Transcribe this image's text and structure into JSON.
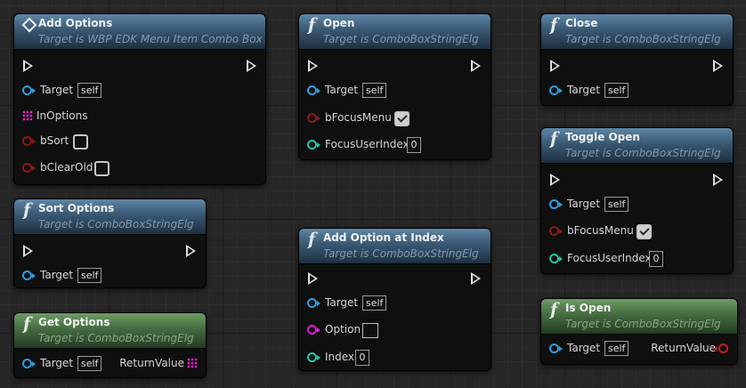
{
  "nodes": {
    "add_options": {
      "title": "Add Options",
      "subtitle": "Target is WBP EDK Menu Item Combo Box",
      "pins": {
        "target": "Target",
        "target_default": "self",
        "in_options": "InOptions",
        "b_sort": "bSort",
        "b_clear_old": "bClearOld"
      },
      "b_sort_checked": false,
      "b_clear_old_checked": false
    },
    "sort_options": {
      "title": "Sort Options",
      "subtitle": "Target is ComboBoxStringElg",
      "pins": {
        "target": "Target",
        "target_default": "self"
      }
    },
    "get_options": {
      "title": "Get Options",
      "subtitle": "Target is ComboBoxStringElg",
      "pins": {
        "target": "Target",
        "target_default": "self",
        "return_value": "ReturnValue"
      }
    },
    "open": {
      "title": "Open",
      "subtitle": "Target is ComboBoxStringElg",
      "pins": {
        "target": "Target",
        "target_default": "self",
        "b_focus_menu": "bFocusMenu",
        "focus_user_index": "FocusUserIndex",
        "focus_user_index_value": "0"
      },
      "b_focus_menu_checked": true
    },
    "add_option_at_index": {
      "title": "Add Option at Index",
      "subtitle": "Target is ComboBoxStringElg",
      "pins": {
        "target": "Target",
        "target_default": "self",
        "option": "Option",
        "index": "Index",
        "index_value": "0"
      }
    },
    "close": {
      "title": "Close",
      "subtitle": "Target is ComboBoxStringElg",
      "pins": {
        "target": "Target",
        "target_default": "self"
      }
    },
    "toggle_open": {
      "title": "Toggle Open",
      "subtitle": "Target is ComboBoxStringElg",
      "pins": {
        "target": "Target",
        "target_default": "self",
        "b_focus_menu": "bFocusMenu",
        "focus_user_index": "FocusUserIndex",
        "focus_user_index_value": "0"
      },
      "b_focus_menu_checked": true
    },
    "is_open": {
      "title": "Is Open",
      "subtitle": "Target is ComboBoxStringElg",
      "pins": {
        "target": "Target",
        "target_default": "self",
        "return_value": "ReturnValue"
      }
    }
  },
  "icons": {
    "function": "f-function-icon",
    "event": "diamond-event-icon",
    "exec": "exec-pin-icon",
    "object": "object-pin-icon",
    "bool": "bool-pin-icon",
    "int": "int-pin-icon",
    "string": "string-pin-icon",
    "array": "array-pin-icon"
  },
  "colors": {
    "impure_header": "#3b5a75",
    "pure_header": "#476e42",
    "object_pin": "#2e9fe0",
    "bool_pin": "#8b1a1a",
    "int_pin": "#22c9a5",
    "string_pin": "#e21ad6",
    "array_pin": "#e021c8",
    "return_bool_pin": "#c22020"
  }
}
